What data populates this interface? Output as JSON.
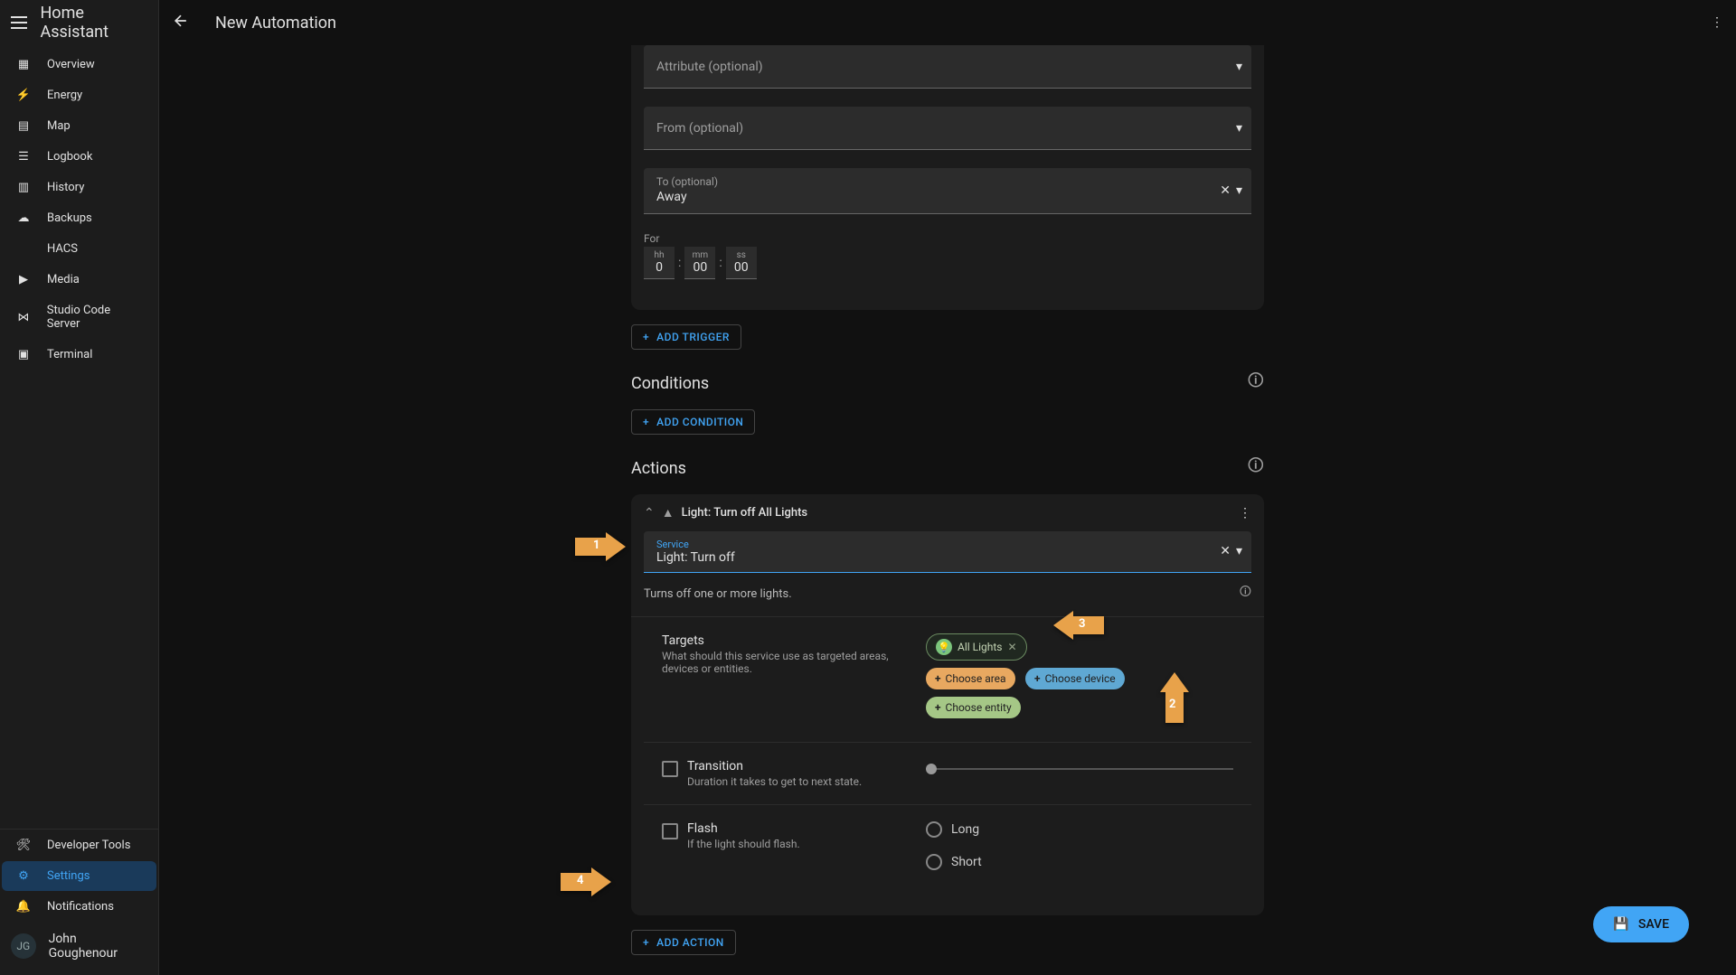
{
  "app_title": "Home Assistant",
  "page_title": "New Automation",
  "sidebar": {
    "items": [
      {
        "label": "Overview",
        "icon": "dashboard"
      },
      {
        "label": "Energy",
        "icon": "flash"
      },
      {
        "label": "Map",
        "icon": "map"
      },
      {
        "label": "Logbook",
        "icon": "list"
      },
      {
        "label": "History",
        "icon": "chart"
      },
      {
        "label": "Backups",
        "icon": "cloud"
      },
      {
        "label": "HACS",
        "icon": ""
      },
      {
        "label": "Media",
        "icon": "play"
      },
      {
        "label": "Studio Code Server",
        "icon": "vscode"
      },
      {
        "label": "Terminal",
        "icon": "terminal"
      }
    ],
    "bottom": [
      {
        "label": "Developer Tools",
        "icon": "hammer"
      },
      {
        "label": "Settings",
        "icon": "gear",
        "active": true
      },
      {
        "label": "Notifications",
        "icon": "bell"
      }
    ],
    "user": {
      "initials": "JG",
      "name": "John Goughenour"
    }
  },
  "trigger": {
    "attribute_label": "Attribute (optional)",
    "from_label": "From (optional)",
    "to_label": "To (optional)",
    "to_value": "Away",
    "for_label": "For",
    "hh_label": "hh",
    "mm_label": "mm",
    "ss_label": "ss",
    "hh": "0",
    "mm": "00",
    "ss": "00",
    "add_trigger": "ADD TRIGGER"
  },
  "conditions": {
    "title": "Conditions",
    "add": "ADD CONDITION"
  },
  "actions": {
    "title": "Actions",
    "card_title": "Light: Turn off All Lights",
    "service_label": "Service",
    "service_value": "Light: Turn off",
    "service_desc": "Turns off one or more lights.",
    "targets_title": "Targets",
    "targets_desc": "What should this service use as targeted areas, devices or entities.",
    "chip_all_lights": "All Lights",
    "chip_area": "Choose area",
    "chip_device": "Choose device",
    "chip_entity": "Choose entity",
    "transition_title": "Transition",
    "transition_desc": "Duration it takes to get to next state.",
    "flash_title": "Flash",
    "flash_desc": "If the light should flash.",
    "flash_long": "Long",
    "flash_short": "Short",
    "add_action": "ADD ACTION"
  },
  "save": "SAVE",
  "annotations": {
    "arrow1": "1",
    "arrow2": "2",
    "arrow3": "3",
    "arrow4": "4"
  },
  "colors": {
    "accent": "#41a5f5",
    "arrow": "#e8a24a"
  }
}
